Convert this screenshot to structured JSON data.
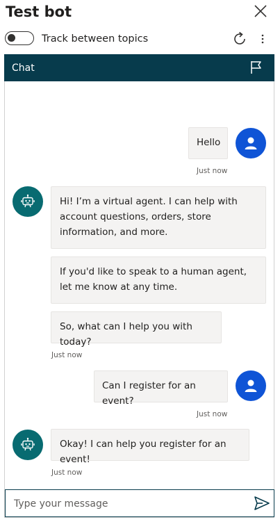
{
  "panel": {
    "title": "Test bot",
    "track_label": "Track between topics"
  },
  "chat": {
    "header_title": "Chat",
    "input_placeholder": "Type your message",
    "messages": [
      {
        "from": "user",
        "text": "Hello",
        "time": "Just now"
      },
      {
        "from": "bot",
        "text": "Hi! I’m a virtual agent. I can help with account questions, orders, store information, and more."
      },
      {
        "from": "bot",
        "text": "If you'd like to speak to a human agent, let me know at any time."
      },
      {
        "from": "bot",
        "text": "So, what can I help you with today?",
        "time": "Just now"
      },
      {
        "from": "user",
        "text": "Can I register for an event?",
        "time": "Just now"
      },
      {
        "from": "bot",
        "text": "Okay! I can help you register for an event!",
        "time": "Just now"
      }
    ]
  },
  "colors": {
    "header_bg": "#073b4c",
    "user_avatar": "#0f54d6",
    "bot_avatar": "#086b71",
    "bubble_bg": "#f4f3f2"
  },
  "icons": {
    "close": "close-icon",
    "refresh": "refresh-icon",
    "more": "more-vertical-icon",
    "flag": "flag-icon",
    "user_avatar": "person-icon",
    "bot_avatar": "bot-icon",
    "send": "send-icon"
  }
}
